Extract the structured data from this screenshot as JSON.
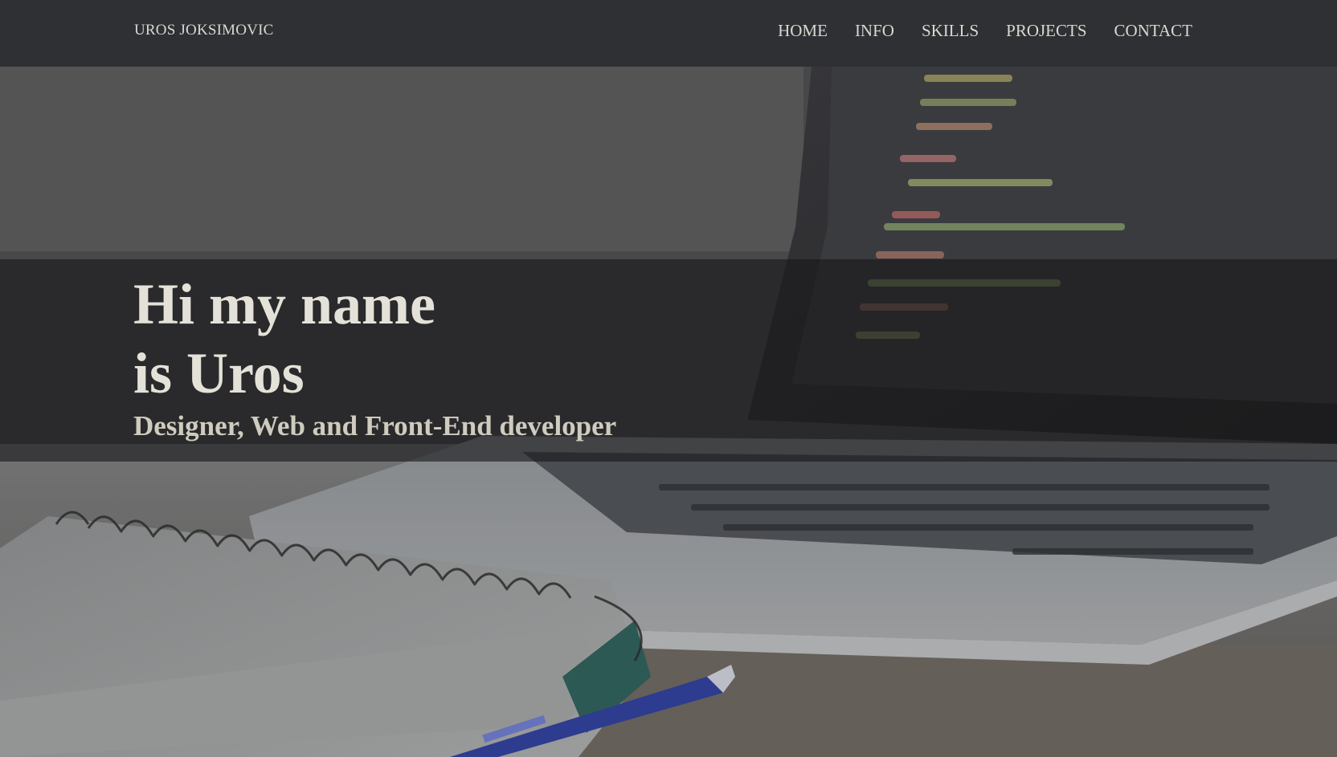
{
  "brand": "UROS JOKSIMOVIC",
  "nav": {
    "items": [
      "HOME",
      "INFO",
      "SKILLS",
      "PROJECTS",
      "CONTACT"
    ]
  },
  "hero": {
    "headline_line1": "Hi my name",
    "headline_line2": "is Uros",
    "subtitle": "Designer, Web and Front-End developer"
  },
  "colors": {
    "navbar_bg": "#2e3033",
    "text_light": "#e4e2d8"
  }
}
